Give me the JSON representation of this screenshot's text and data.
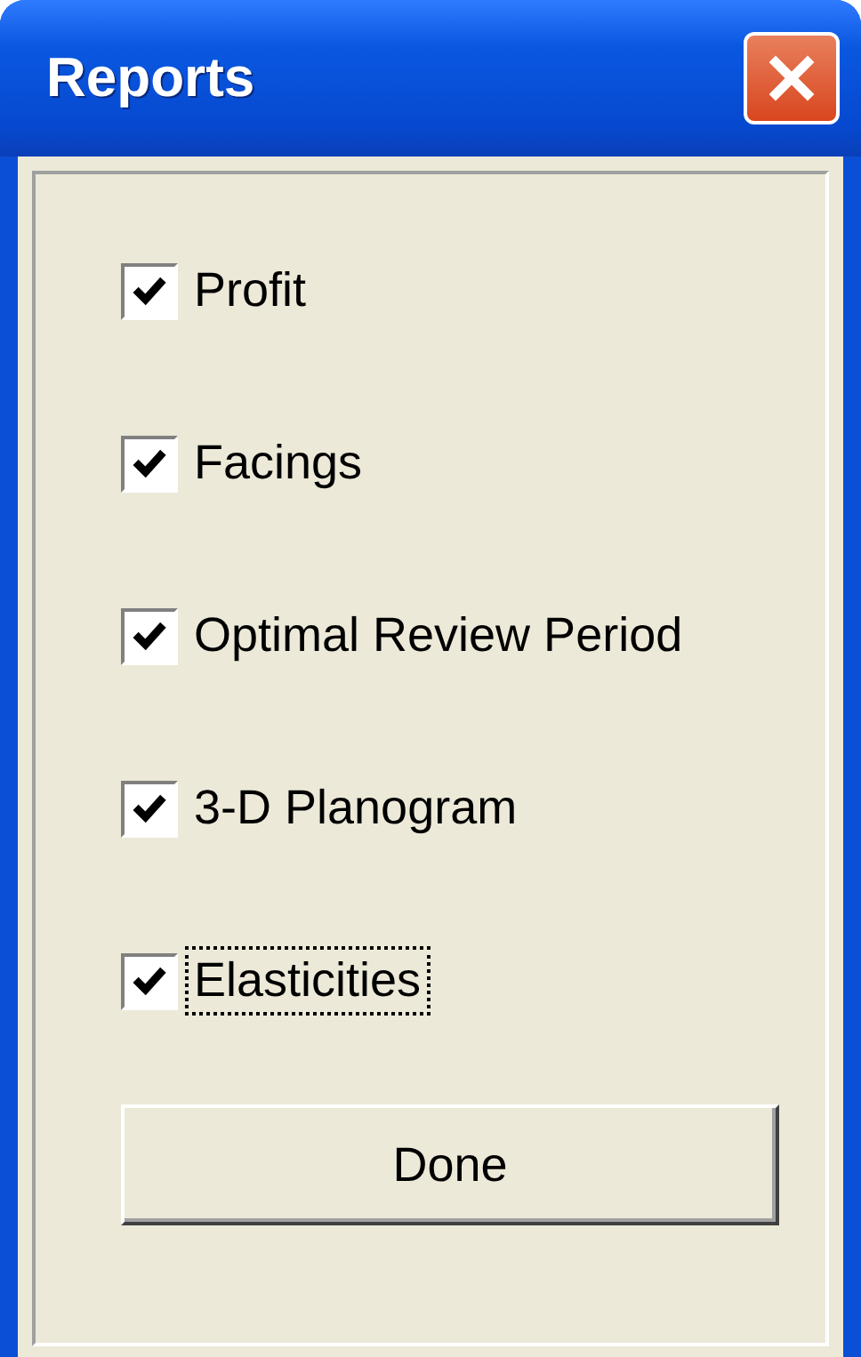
{
  "window": {
    "title": "Reports"
  },
  "options": [
    {
      "label": "Profit",
      "checked": true,
      "focused": false
    },
    {
      "label": "Facings",
      "checked": true,
      "focused": false
    },
    {
      "label": "Optimal Review Period",
      "checked": true,
      "focused": false
    },
    {
      "label": "3-D Planogram",
      "checked": true,
      "focused": false
    },
    {
      "label": "Elasticities",
      "checked": true,
      "focused": true
    }
  ],
  "buttons": [
    {
      "label": "Done"
    }
  ]
}
